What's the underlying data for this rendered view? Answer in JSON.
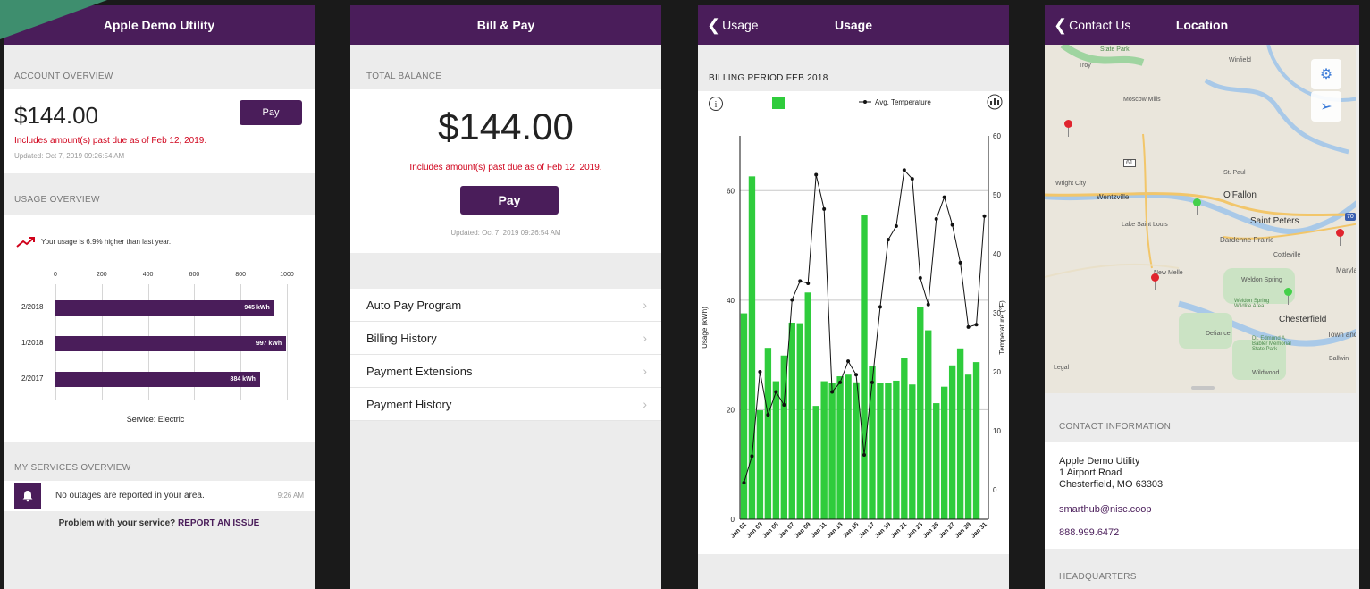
{
  "screen1": {
    "title": "Apple Demo Utility",
    "account_header": "ACCOUNT OVERVIEW",
    "amount": "$144.00",
    "pay_label": "Pay",
    "past_due": "Includes amount(s) past due as of Feb 12, 2019.",
    "updated": "Updated: Oct 7, 2019 09:26:54 AM",
    "usage_header": "USAGE OVERVIEW",
    "usage_note": "Your usage is 6.9% higher than last year.",
    "axis_ticks": [
      "0",
      "200",
      "400",
      "600",
      "800",
      "1000"
    ],
    "bars": [
      {
        "label": "2/2018",
        "value_text": "945 kWh",
        "value": 945
      },
      {
        "label": "1/2018",
        "value_text": "997 kWh",
        "value": 997
      },
      {
        "label": "2/2017",
        "value_text": "884 kWh",
        "value": 884
      }
    ],
    "service": "Service: Electric",
    "services_header": "MY SERVICES OVERVIEW",
    "outage_text": "No outages are reported in your area.",
    "outage_time": "9:26 AM",
    "problem_text": "Problem with your service?",
    "report_text": "REPORT AN ISSUE"
  },
  "screen2": {
    "title": "Bill & Pay",
    "balance_header": "TOTAL BALANCE",
    "amount": "$144.00",
    "past_due": "Includes amount(s) past due as of Feb 12, 2019.",
    "pay_label": "Pay",
    "updated": "Updated: Oct 7, 2019 09:26:54 AM",
    "menu": [
      "Auto Pay Program",
      "Billing History",
      "Payment Extensions",
      "Payment History"
    ]
  },
  "screen3": {
    "back_label": "Usage",
    "title": "Usage",
    "period": "BILLING PERIOD FEB 2018",
    "legend_temp": "Avg. Temperature"
  },
  "screen4": {
    "back_label": "Contact Us",
    "title": "Location",
    "map_labels": {
      "state_park": "State Park",
      "troy": "Troy",
      "winfield": "Winfield",
      "moscow_mills": "Moscow Mills",
      "route61": "61",
      "st_paul": "St. Paul",
      "wright_city": "Wright City",
      "wentzville": "Wentzville",
      "ofallon": "O'Fallon",
      "lake_saint_louis": "Lake Saint Louis",
      "saint_peters": "Saint Peters",
      "dardenne_prairie": "Dardenne Prairie",
      "cottleville": "Cottleville",
      "maryland": "Maryla",
      "new_melle": "New Melle",
      "weldon_spring": "Weldon Spring",
      "weldon_wildlife": "Weldon Spring Wildlife Area",
      "chesterfield": "Chesterfield",
      "defiance": "Defiance",
      "town_and": "Town and",
      "dr_edmund": "Dr. Edmund A. Babler Memorial State Park",
      "ballwin": "Ballwin",
      "legal": "Legal",
      "wildwood": "Wildwood",
      "route70": "70"
    },
    "contact_header": "CONTACT INFORMATION",
    "address_lines": [
      "Apple Demo Utility",
      "1 Airport Road",
      "Chesterfield, MO 63303"
    ],
    "email": "smarthub@nisc.coop",
    "phone": "888.999.6472",
    "hq_header": "HEADQUARTERS"
  },
  "colors": {
    "brand": "#4a1d5a",
    "alert": "#d0021b",
    "usage_bar": "#2fcc3c",
    "pin_red": "#e0242e",
    "pin_green": "#44d04a"
  },
  "chart_data": {
    "type": "bar",
    "title": "BILLING PERIOD FEB 2018",
    "xlabel": "",
    "ylabel": "Usage (kWh)",
    "y2label": "Temperature (°F)",
    "ylim": [
      0,
      70
    ],
    "y2lim": [
      -5,
      60
    ],
    "yticks": [
      0,
      20,
      40,
      60
    ],
    "y2ticks": [
      0,
      10,
      20,
      30,
      40,
      50,
      60
    ],
    "categories": [
      "Jan 01",
      "Jan 02",
      "Jan 03",
      "Jan 04",
      "Jan 05",
      "Jan 06",
      "Jan 07",
      "Jan 08",
      "Jan 09",
      "Jan 10",
      "Jan 11",
      "Jan 12",
      "Jan 13",
      "Jan 14",
      "Jan 15",
      "Jan 16",
      "Jan 17",
      "Jan 18",
      "Jan 19",
      "Jan 20",
      "Jan 21",
      "Jan 22",
      "Jan 23",
      "Jan 24",
      "Jan 25",
      "Jan 26",
      "Jan 27",
      "Jan 28",
      "Jan 29",
      "Jan 30",
      "Jan 31"
    ],
    "tick_labels": [
      "Jan 01",
      "Jan 03",
      "Jan 05",
      "Jan 07",
      "Jan 09",
      "Jan 11",
      "Jan 13",
      "Jan 15",
      "Jan 17",
      "Jan 19",
      "Jan 21",
      "Jan 23",
      "Jan 25",
      "Jan 27",
      "Jan 29",
      "Jan 31"
    ],
    "series": [
      {
        "type": "bar",
        "values": [
          37.6,
          62.6,
          19.9,
          31.3,
          25.2,
          29.9,
          35.9,
          35.8,
          41.4,
          20.7,
          25.2,
          24.9,
          26.1,
          26.4,
          25.0,
          55.6,
          27.9,
          24.9,
          24.9,
          25.3,
          29.5,
          24.6,
          38.8,
          34.5,
          21.2,
          24.2,
          28.1,
          31.2,
          26.4,
          28.7,
          0
        ]
      },
      {
        "name": "Avg. Temperature",
        "type": "line",
        "axis": "y2",
        "values": [
          1.2,
          5.7,
          20.0,
          12.7,
          16.6,
          14.4,
          32.2,
          35.4,
          35.0,
          53.4,
          47.6,
          16.6,
          18.2,
          21.8,
          19.5,
          5.9,
          18.2,
          31.0,
          42.4,
          44.7,
          54.2,
          52.7,
          35.9,
          31.4,
          45.9,
          49.6,
          44.9,
          38.5,
          27.6,
          28.0,
          46.4
        ]
      }
    ]
  }
}
